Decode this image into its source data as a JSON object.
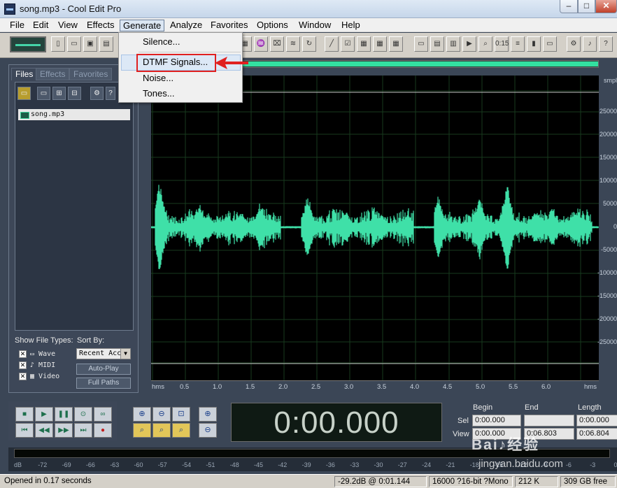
{
  "window": {
    "title": "song.mp3 - Cool Edit Pro",
    "min_glyph": "–",
    "max_glyph": "□",
    "close_glyph": "✕"
  },
  "menubar": [
    "File",
    "Edit",
    "View",
    "Effects",
    "Generate",
    "Analyze",
    "Favorites",
    "Options",
    "Window",
    "Help"
  ],
  "generate_menu": {
    "items": [
      "Silence...",
      "DTMF Signals...",
      "Noise...",
      "Tones..."
    ],
    "highlighted": "DTMF Signals..."
  },
  "toolbar": {
    "icons": [
      "mode-toggle-icon",
      "new-icon",
      "open-icon",
      "save-icon",
      "save-as-icon",
      "cut-icon",
      "copy-icon",
      "paste-icon",
      "mix-paste-icon",
      "trim-icon",
      "delete-icon",
      "insert-icon",
      "undo-icon",
      "wave-icon",
      "crop-icon",
      "noise-icon",
      "loop-icon",
      "fx-icon",
      "frequency-icon",
      "spectral-icon",
      "grid-icon",
      "grid2-icon",
      "grid3-icon",
      "window-icon",
      "window2-icon",
      "window3-icon",
      "play-icon",
      "zoom-icon",
      "time-icon",
      "ebe-icon",
      "color-icon",
      "strip-icon",
      "multi-icon",
      "help-icon"
    ],
    "time_glyph": "0:15"
  },
  "left_panel": {
    "tabs": [
      "Files",
      "Effects",
      "Favorites"
    ],
    "files": [
      "song.mp3"
    ],
    "show_file_types_label": "Show File Types:",
    "file_types": [
      {
        "label": "Wave",
        "checked": true
      },
      {
        "label": "MIDI",
        "checked": true
      },
      {
        "label": "Video",
        "checked": true
      }
    ],
    "sort_by_label": "Sort By:",
    "sort_by_value": "Recent Acc",
    "auto_play_label": "Auto-Play",
    "full_paths_label": "Full Paths"
  },
  "waveform": {
    "color": "#3fe0a8",
    "right_ruler": [
      "smpl",
      "25000",
      "20000",
      "15000",
      "10000",
      "5000",
      "0",
      "-5000",
      "-10000",
      "-15000",
      "-20000",
      "-25000"
    ],
    "time_ticks": [
      "hms",
      "0.5",
      "1.0",
      "1.5",
      "2.0",
      "2.5",
      "3.0",
      "3.5",
      "4.0",
      "4.5",
      "5.0",
      "5.5",
      "6.0",
      "hms"
    ],
    "duration_s": 6.803,
    "viewed_fraction": 0.8
  },
  "transport": {
    "time_display": "0:00.000"
  },
  "selview": {
    "headers": [
      "Begin",
      "End",
      "Length"
    ],
    "sel_label": "Sel",
    "view_label": "View",
    "sel": [
      "0:00.000",
      "",
      "0:00.000"
    ],
    "view": [
      "0:00.000",
      "0:06.803",
      "0:06.804"
    ]
  },
  "level_meter": {
    "ticks": [
      "dB",
      "-72",
      "-69",
      "-66",
      "-63",
      "-60",
      "-57",
      "-54",
      "-51",
      "-48",
      "-45",
      "-42",
      "-39",
      "-36",
      "-33",
      "-30",
      "-27",
      "-24",
      "-21",
      "-18",
      "-15",
      "-12",
      "-9",
      "-6",
      "-3",
      "0"
    ]
  },
  "statusbar": {
    "opened": "Opened in 0.17 seconds",
    "level": "-29.2dB @  0:01.144",
    "format": "16000 ?16-bit ?Mono",
    "size": "212 K",
    "free": "309 GB free"
  },
  "watermark": {
    "text": "Bai♪经验",
    "url": "jingyan.baidu.com"
  }
}
